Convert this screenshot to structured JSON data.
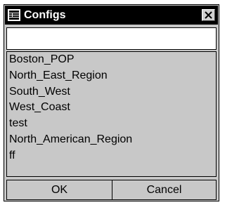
{
  "window": {
    "title": "Configs",
    "icon": "app-window-icon",
    "close_icon": "close-icon"
  },
  "filter": {
    "value": ""
  },
  "list": {
    "items": [
      "Boston_POP",
      "North_East_Region",
      "South_West",
      "West_Coast",
      "test",
      "North_American_Region",
      "ff"
    ]
  },
  "buttons": {
    "ok": "OK",
    "cancel": "Cancel"
  },
  "figure_id": "12906"
}
